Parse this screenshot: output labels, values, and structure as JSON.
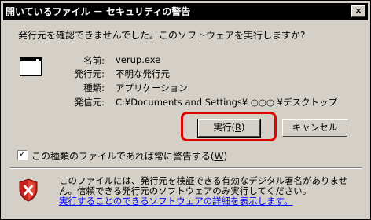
{
  "window": {
    "title": "開いているファイル － セキュリティの警告",
    "close_glyph": "×"
  },
  "question": "発行元を確認できませんでした。このソフトウェアを実行しますか?",
  "file_icon": "application-window-icon",
  "details": [
    {
      "label": "名前:",
      "value": "verup.exe"
    },
    {
      "label": "発行元:",
      "value": "不明な発行元"
    },
    {
      "label": "種類:",
      "value": "アプリケーション"
    },
    {
      "label": "発信元:",
      "value": "C:¥Documents and Settings¥ ○○○ ¥デスクトップ"
    }
  ],
  "buttons": {
    "run_label": "実行(",
    "run_mnemonic": "R",
    "run_suffix": ")",
    "cancel_label": "キャンセル"
  },
  "checkbox": {
    "label": "この種類のファイルであれば常に警告する(",
    "mnemonic": "W",
    "suffix": ")",
    "checked": true,
    "check_glyph": "✓"
  },
  "warning": {
    "text": "このファイルには、発行元を検証できる有効なデジタル署名がありません。信頼できる発行元のソフトウェアのみ実行してください。",
    "link": "実行することのできるソフトウェアの詳細を表示します。",
    "icon": "shield-x-icon"
  },
  "colors": {
    "highlight": "#e00000",
    "link": "#0000ff"
  }
}
